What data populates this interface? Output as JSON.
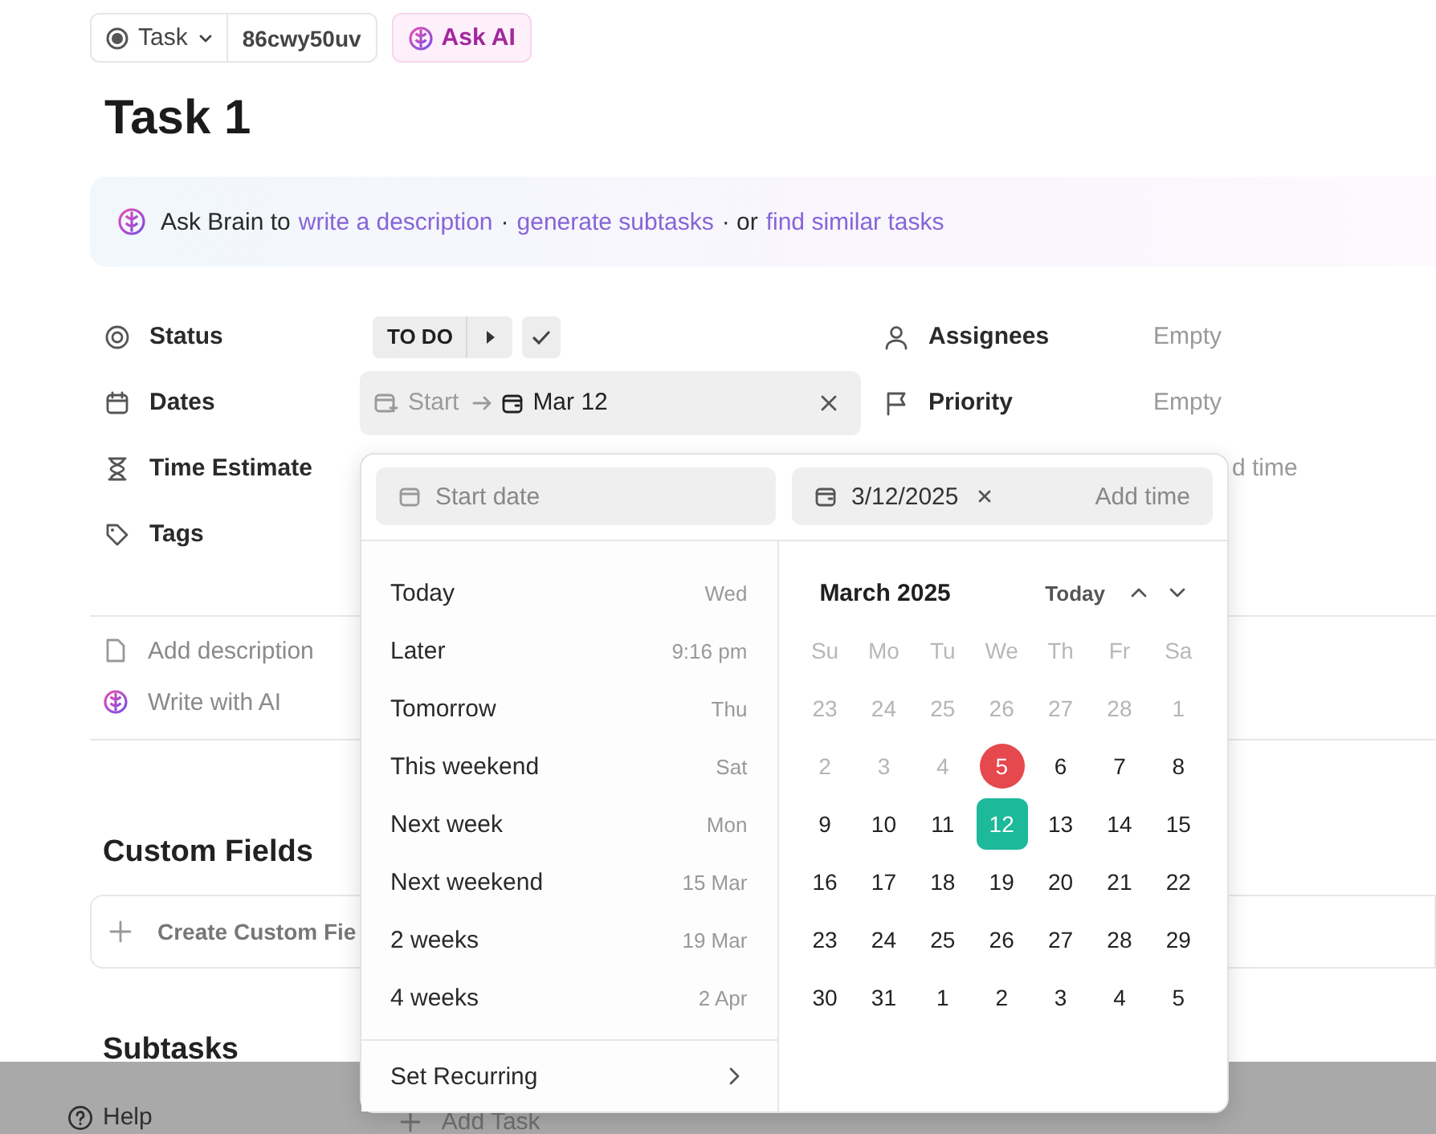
{
  "header": {
    "type_button": "Task",
    "task_id": "86cwy50uv",
    "ask_ai": "Ask AI"
  },
  "title": "Task 1",
  "ai_banner": [
    {
      "kind": "text",
      "text": "Ask Brain to"
    },
    {
      "kind": "link",
      "text": "write a description"
    },
    {
      "kind": "text",
      "text": "·"
    },
    {
      "kind": "link",
      "text": "generate subtasks"
    },
    {
      "kind": "text",
      "text": "· or"
    },
    {
      "kind": "link",
      "text": "find similar tasks"
    }
  ],
  "properties": [
    {
      "kind": "status",
      "label": "Status",
      "value": "TO DO"
    },
    {
      "kind": "dates",
      "label": "Dates",
      "start": "Start",
      "due": "Mar 12"
    },
    {
      "kind": "time",
      "label": "Time Estimate"
    },
    {
      "kind": "tags",
      "label": "Tags"
    }
  ],
  "side_properties": [
    {
      "kind": "assignees",
      "label": "Assignees",
      "value": "Empty"
    },
    {
      "kind": "priority",
      "label": "Priority",
      "value": "Empty"
    },
    {
      "kind": "partial",
      "value": "d time"
    }
  ],
  "description_actions": [
    {
      "kind": "doc",
      "label": "Add description"
    },
    {
      "kind": "ai",
      "label": "Write with AI"
    }
  ],
  "custom_fields": {
    "title": "Custom Fields",
    "create": "Create Custom Fie"
  },
  "subtasks": {
    "title": "Subtasks"
  },
  "bottom_bar": {
    "help": "Help",
    "add_task": "Add Task"
  },
  "date_picker": {
    "start_placeholder": "Start date",
    "due_value": "3/12/2025",
    "add_time": "Add time",
    "shortcuts": [
      {
        "label": "Today",
        "hint": "Wed"
      },
      {
        "label": "Later",
        "hint": "9:16 pm"
      },
      {
        "label": "Tomorrow",
        "hint": "Thu"
      },
      {
        "label": "This weekend",
        "hint": "Sat"
      },
      {
        "label": "Next week",
        "hint": "Mon"
      },
      {
        "label": "Next weekend",
        "hint": "15 Mar"
      },
      {
        "label": "2 weeks",
        "hint": "19 Mar"
      },
      {
        "label": "4 weeks",
        "hint": "2 Apr"
      }
    ],
    "recurring": "Set Recurring",
    "calendar": {
      "month": "March 2025",
      "today_button": "Today",
      "weekdays": [
        "Su",
        "Mo",
        "Tu",
        "We",
        "Th",
        "Fr",
        "Sa"
      ],
      "days": [
        {
          "label": "23",
          "muted": true,
          "today": false,
          "selected": false
        },
        {
          "label": "24",
          "muted": true,
          "today": false,
          "selected": false
        },
        {
          "label": "25",
          "muted": true,
          "today": false,
          "selected": false
        },
        {
          "label": "26",
          "muted": true,
          "today": false,
          "selected": false
        },
        {
          "label": "27",
          "muted": true,
          "today": false,
          "selected": false
        },
        {
          "label": "28",
          "muted": true,
          "today": false,
          "selected": false
        },
        {
          "label": "1",
          "muted": true,
          "today": false,
          "selected": false
        },
        {
          "label": "2",
          "muted": true,
          "today": false,
          "selected": false
        },
        {
          "label": "3",
          "muted": true,
          "today": false,
          "selected": false
        },
        {
          "label": "4",
          "muted": true,
          "today": false,
          "selected": false
        },
        {
          "label": "5",
          "muted": false,
          "today": true,
          "selected": false
        },
        {
          "label": "6",
          "muted": false,
          "today": false,
          "selected": false
        },
        {
          "label": "7",
          "muted": false,
          "today": false,
          "selected": false
        },
        {
          "label": "8",
          "muted": false,
          "today": false,
          "selected": false
        },
        {
          "label": "9",
          "muted": false,
          "today": false,
          "selected": false
        },
        {
          "label": "10",
          "muted": false,
          "today": false,
          "selected": false
        },
        {
          "label": "11",
          "muted": false,
          "today": false,
          "selected": false
        },
        {
          "label": "12",
          "muted": false,
          "today": false,
          "selected": true
        },
        {
          "label": "13",
          "muted": false,
          "today": false,
          "selected": false
        },
        {
          "label": "14",
          "muted": false,
          "today": false,
          "selected": false
        },
        {
          "label": "15",
          "muted": false,
          "today": false,
          "selected": false
        },
        {
          "label": "16",
          "muted": false,
          "today": false,
          "selected": false
        },
        {
          "label": "17",
          "muted": false,
          "today": false,
          "selected": false
        },
        {
          "label": "18",
          "muted": false,
          "today": false,
          "selected": false
        },
        {
          "label": "19",
          "muted": false,
          "today": false,
          "selected": false
        },
        {
          "label": "20",
          "muted": false,
          "today": false,
          "selected": false
        },
        {
          "label": "21",
          "muted": false,
          "today": false,
          "selected": false
        },
        {
          "label": "22",
          "muted": false,
          "today": false,
          "selected": false
        },
        {
          "label": "23",
          "muted": false,
          "today": false,
          "selected": false
        },
        {
          "label": "24",
          "muted": false,
          "today": false,
          "selected": false
        },
        {
          "label": "25",
          "muted": false,
          "today": false,
          "selected": false
        },
        {
          "label": "26",
          "muted": false,
          "today": false,
          "selected": false
        },
        {
          "label": "27",
          "muted": false,
          "today": false,
          "selected": false
        },
        {
          "label": "28",
          "muted": false,
          "today": false,
          "selected": false
        },
        {
          "label": "29",
          "muted": false,
          "today": false,
          "selected": false
        },
        {
          "label": "30",
          "muted": false,
          "today": false,
          "selected": false
        },
        {
          "label": "31",
          "muted": false,
          "today": false,
          "selected": false
        },
        {
          "label": "1",
          "muted": false,
          "today": false,
          "selected": false
        },
        {
          "label": "2",
          "muted": false,
          "today": false,
          "selected": false
        },
        {
          "label": "3",
          "muted": false,
          "today": false,
          "selected": false
        },
        {
          "label": "4",
          "muted": false,
          "today": false,
          "selected": false
        },
        {
          "label": "5",
          "muted": false,
          "today": false,
          "selected": false
        }
      ]
    }
  }
}
